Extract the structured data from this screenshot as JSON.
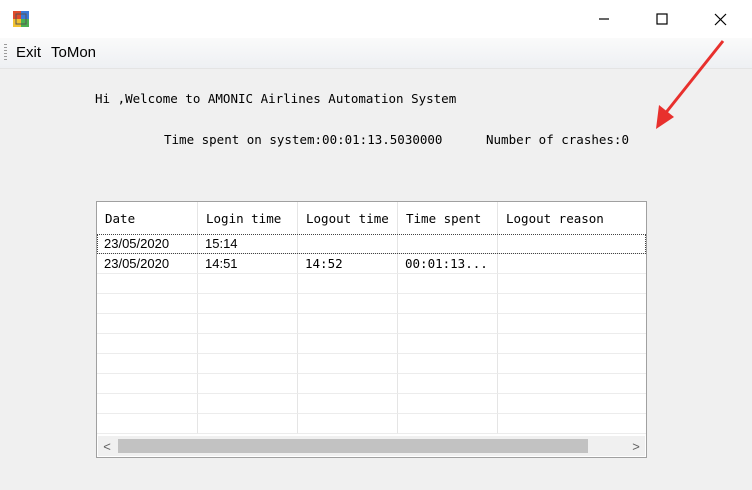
{
  "window": {
    "minimize_glyph": "—",
    "maximize_glyph": "☐",
    "close_glyph": "✕"
  },
  "menu": {
    "items": [
      {
        "label": "Exit"
      },
      {
        "label": "ToMon"
      }
    ]
  },
  "welcome_text": "Hi ,Welcome to AMONIC Airlines Automation System",
  "time_spent_text": "Time spent on system:00:01:13.5030000",
  "crashes_text": "Number of crashes:0",
  "grid": {
    "columns": [
      "Date",
      "Login time",
      "Logout time",
      "Time spent",
      "Logout reason"
    ],
    "rows": [
      [
        "23/05/2020",
        "15:14",
        "",
        "",
        ""
      ],
      [
        "23/05/2020",
        "14:51",
        "14:52",
        "00:01:13...",
        ""
      ]
    ],
    "empty_rows": 8
  },
  "colors": {
    "annotation_arrow": "#e8302d"
  }
}
